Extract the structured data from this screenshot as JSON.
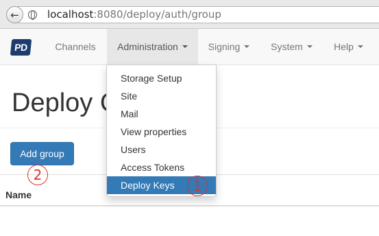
{
  "browser": {
    "url_host": "localhost",
    "url_rest": ":8080/deploy/auth/group"
  },
  "navbar": {
    "logo": "PD",
    "items": [
      {
        "label": "Channels"
      },
      {
        "label": "Administration"
      },
      {
        "label": "Signing"
      },
      {
        "label": "System"
      },
      {
        "label": "Help"
      }
    ]
  },
  "dropdown": {
    "items": [
      {
        "label": "Storage Setup"
      },
      {
        "label": "Site"
      },
      {
        "label": "Mail"
      },
      {
        "label": "View properties"
      },
      {
        "label": "Users"
      },
      {
        "label": "Access Tokens"
      },
      {
        "label": "Deploy Keys",
        "selected": true
      }
    ]
  },
  "page": {
    "title": "Deploy Groups",
    "add_button": "Add group",
    "table_header_name": "Name"
  },
  "annotations": {
    "marker_1": "1",
    "marker_2": "2"
  },
  "colors": {
    "primary": "#337ab7",
    "marker": "#e0302a",
    "navbar_bg": "#f8f8f8",
    "logo_bg": "#1d3c6e"
  }
}
